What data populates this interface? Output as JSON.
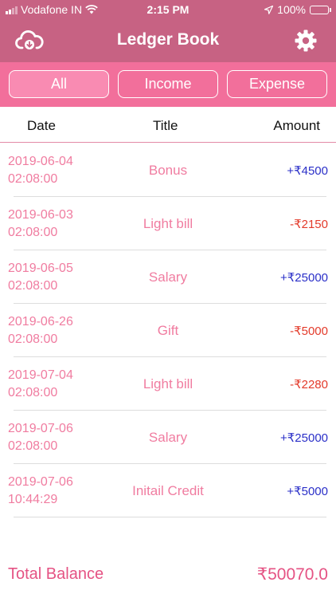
{
  "status_bar": {
    "carrier": "Vodafone IN",
    "time": "2:15 PM",
    "battery": "100%"
  },
  "nav": {
    "title": "Ledger Book",
    "left_icon": "cloud-download-icon",
    "right_icon": "gear-icon"
  },
  "filters": {
    "all": "All",
    "income": "Income",
    "expense": "Expense",
    "selected": "All"
  },
  "table": {
    "headers": {
      "date": "Date",
      "title": "Title",
      "amount": "Amount"
    },
    "rows": [
      {
        "date": "2019-06-04",
        "time": "02:08:00",
        "title": "Bonus",
        "amount": "+₹4500",
        "type": "income"
      },
      {
        "date": "2019-06-03",
        "time": "02:08:00",
        "title": "Light bill",
        "amount": "-₹2150",
        "type": "expense"
      },
      {
        "date": "2019-06-05",
        "time": "02:08:00",
        "title": "Salary",
        "amount": "+₹25000",
        "type": "income"
      },
      {
        "date": "2019-06-26",
        "time": "02:08:00",
        "title": "Gift",
        "amount": "-₹5000",
        "type": "expense"
      },
      {
        "date": "2019-07-04",
        "time": "02:08:00",
        "title": "Light bill",
        "amount": "-₹2280",
        "type": "expense"
      },
      {
        "date": "2019-07-06",
        "time": "02:08:00",
        "title": "Salary",
        "amount": "+₹25000",
        "type": "income"
      },
      {
        "date": "2019-07-06",
        "time": "10:44:29",
        "title": "Initail Credit",
        "amount": "+₹5000",
        "type": "income"
      }
    ]
  },
  "footer": {
    "label": "Total Balance",
    "value": "₹50070.0"
  },
  "colors": {
    "header": "#c76283",
    "segment_bar": "#f26f9b",
    "accent_text": "#f07ca0",
    "income": "#2a2fc8",
    "expense": "#e33a2a",
    "total": "#e55384"
  }
}
